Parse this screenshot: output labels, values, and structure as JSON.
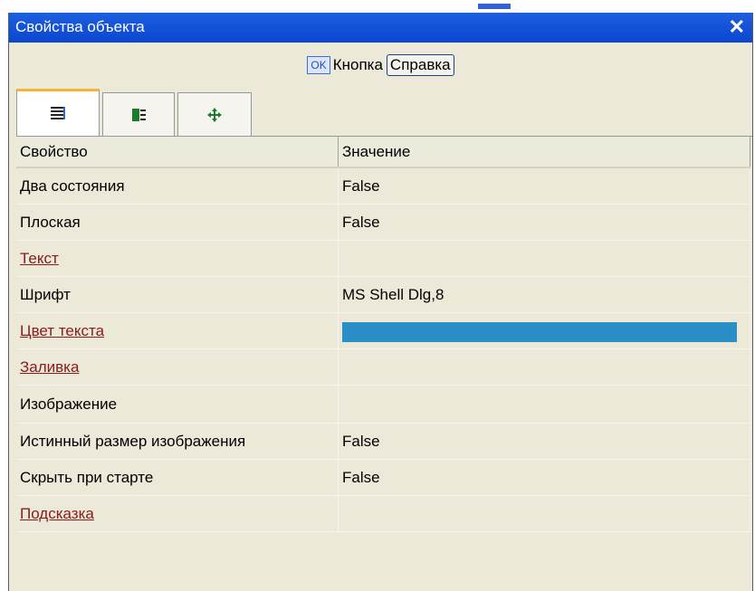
{
  "window": {
    "title": "Свойства объекта",
    "close_symbol": "✕"
  },
  "toolbar": {
    "ok_label": "OK",
    "button_label": "Кнопка",
    "help_label": "Справка"
  },
  "tabs": [
    {
      "icon": "properties-list-icon",
      "active": true
    },
    {
      "icon": "events-icon",
      "active": false
    },
    {
      "icon": "move-icon",
      "active": false
    }
  ],
  "grid": {
    "headers": [
      "Свойство",
      "Значение"
    ],
    "rows": [
      {
        "name": "Два состояния",
        "value": "False",
        "link": false
      },
      {
        "name": "Плоская",
        "value": "False",
        "link": false
      },
      {
        "name": "Текст",
        "value": "",
        "link": true
      },
      {
        "name": "Шрифт",
        "value": "MS Shell Dlg,8",
        "link": false
      },
      {
        "name": "Цвет текста",
        "value": "",
        "link": true,
        "color": "#2a8ec7"
      },
      {
        "name": "Заливка",
        "value": "",
        "link": true
      },
      {
        "name": "Изображение",
        "value": "",
        "link": false
      },
      {
        "name": "Истинный размер изображения",
        "value": "False",
        "link": false
      },
      {
        "name": "Скрыть при старте",
        "value": "False",
        "link": false
      },
      {
        "name": "Подсказка",
        "value": "",
        "link": true
      }
    ]
  }
}
